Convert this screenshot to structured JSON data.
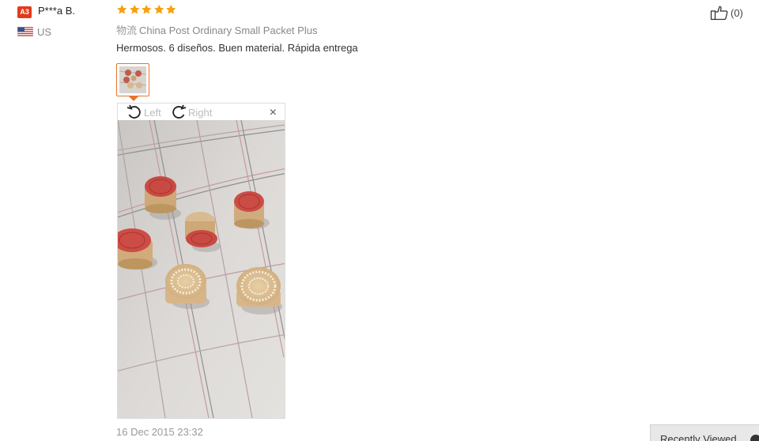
{
  "reviewer": {
    "badge_text": "A3",
    "name": "P***a B.",
    "country": "US",
    "flag_icon": "us-flag-icon"
  },
  "rating": {
    "stars": 5,
    "max": 5,
    "color": "#f7a00f"
  },
  "shipping": {
    "label": "物流",
    "method": "China Post Ordinary Small Packet Plus"
  },
  "review": {
    "text": "Hermosos. 6 diseños. Buen material. Rápida entrega"
  },
  "viewer": {
    "rotate_left_label": "Left",
    "rotate_right_label": "Right",
    "close_label": "×"
  },
  "date": "16 Dec 2015 23:32",
  "helpful": {
    "count": "(0)"
  },
  "recently_viewed": {
    "label": "Recently Viewed"
  },
  "colors": {
    "accent": "#e8752b",
    "badge": "#e23b1c"
  }
}
